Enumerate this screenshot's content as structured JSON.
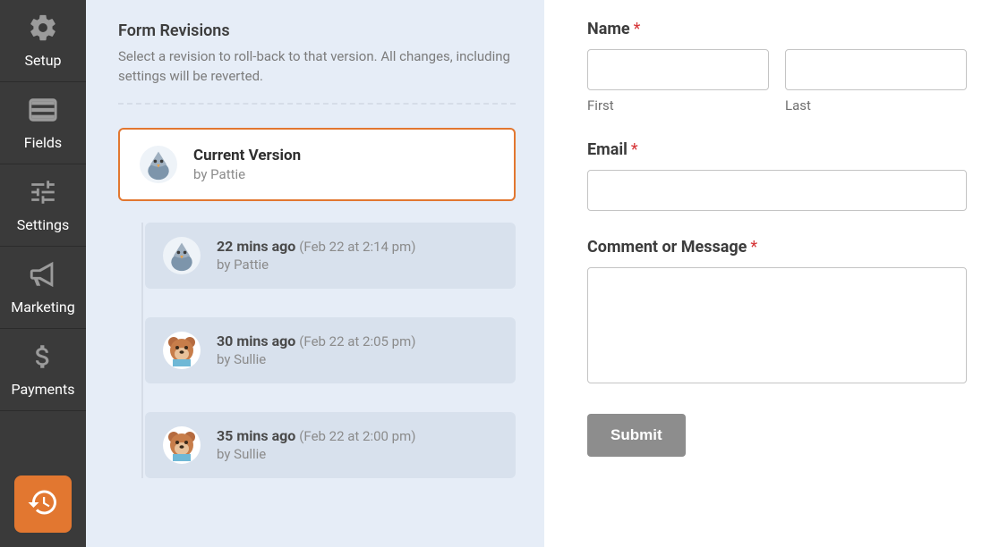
{
  "sidebar": {
    "items": [
      {
        "label": "Setup",
        "icon": "gear-icon"
      },
      {
        "label": "Fields",
        "icon": "list-icon"
      },
      {
        "label": "Settings",
        "icon": "sliders-icon"
      },
      {
        "label": "Marketing",
        "icon": "bullhorn-icon"
      },
      {
        "label": "Payments",
        "icon": "dollar-icon"
      }
    ],
    "revisions_button": {
      "icon": "history-icon"
    }
  },
  "revisions": {
    "heading": "Form Revisions",
    "description": "Select a revision to roll-back to that version. All changes, including settings will be reverted.",
    "current": {
      "title": "Current Version",
      "byline": "by Pattie",
      "avatar": "pigeon"
    },
    "history": [
      {
        "ago": "22 mins ago",
        "date": "(Feb 22 at 2:14 pm)",
        "byline": "by Pattie",
        "avatar": "pigeon"
      },
      {
        "ago": "30 mins ago",
        "date": "(Feb 22 at 2:05 pm)",
        "byline": "by Sullie",
        "avatar": "bear"
      },
      {
        "ago": "35 mins ago",
        "date": "(Feb 22 at 2:00 pm)",
        "byline": "by Sullie",
        "avatar": "bear"
      }
    ]
  },
  "form": {
    "name": {
      "label": "Name",
      "required_mark": "*",
      "first": {
        "sublabel": "First",
        "value": ""
      },
      "last": {
        "sublabel": "Last",
        "value": ""
      }
    },
    "email": {
      "label": "Email",
      "required_mark": "*",
      "value": ""
    },
    "comment": {
      "label": "Comment or Message",
      "required_mark": "*",
      "value": ""
    },
    "submit": {
      "label": "Submit"
    }
  },
  "colors": {
    "accent": "#e27730",
    "sidebar_bg": "#3a3a3a",
    "panel_bg": "#e6edf7",
    "card_bg": "#d8e1ed"
  }
}
